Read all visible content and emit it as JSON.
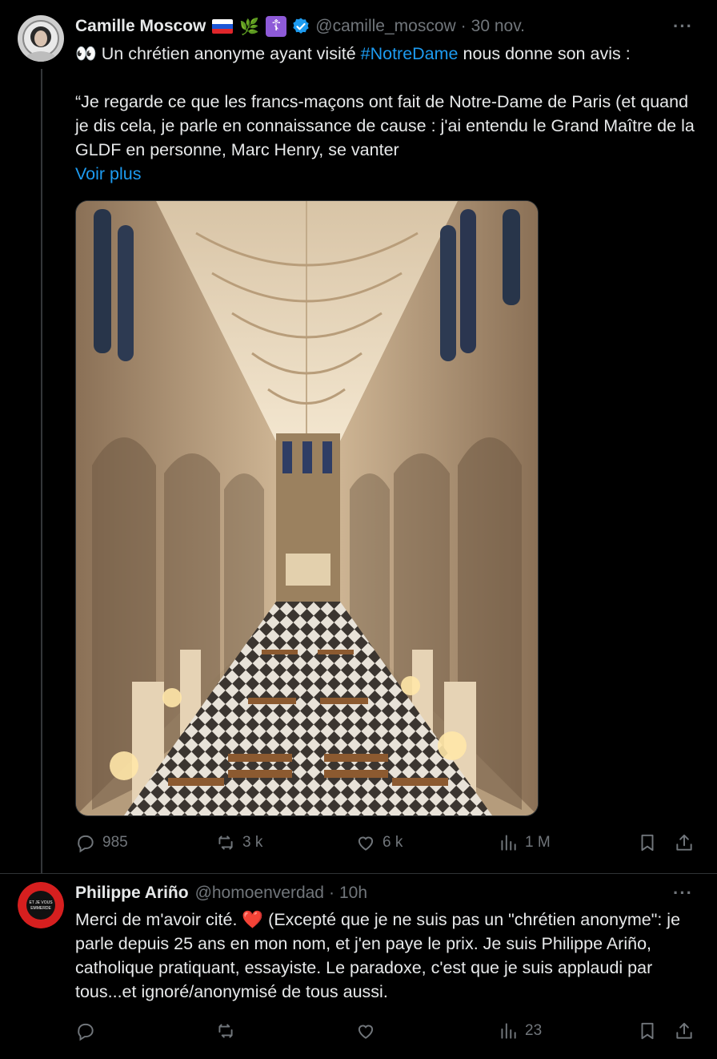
{
  "tweet1": {
    "name": "Camille Moscow",
    "badge_emoji": "🌿",
    "badge_cross": "☦",
    "handle": "@camille_moscow",
    "time": "30 nov.",
    "line1_emoji": "👀",
    "line1_before": " Un chrétien anonyme ayant visité ",
    "hashtag": "#NotreDame",
    "line1_after": " nous donne son avis :",
    "quote": "“Je regarde ce que les francs-maçons ont fait de Notre-Dame de Paris (et quand je dis cela, je parle en connaissance de cause : j'ai entendu le Grand Maître de la GLDF en personne, Marc Henry, se vanter",
    "see_more": "Voir plus",
    "replies": "985",
    "reposts": "3 k",
    "likes": "6 k",
    "views": "1 M"
  },
  "tweet2": {
    "name": "Philippe Ariño",
    "handle": "@homoenverdad",
    "time": "10h",
    "text_before": "Merci de m'avoir cité. ",
    "heart": "❤️",
    "text_after": " (Excepté que je ne suis pas un \"chrétien anonyme\": je parle depuis 25 ans en mon nom, et j'en paye le prix. Je suis Philippe Ariño, catholique pratiquant, essayiste. Le paradoxe, c'est que je suis applaudi par tous...et ignoré/anonymisé de tous aussi.",
    "avatar_ring_text": "JE SUIS PAS VACCINÉ",
    "avatar_center_text_1": "ET JE VOUS",
    "avatar_center_text_2": "EMMERDE",
    "views": "23"
  },
  "more_icon": "···",
  "colors": {
    "link": "#1d9bf0",
    "muted": "#71767b",
    "verified": "#1d9bf0"
  }
}
